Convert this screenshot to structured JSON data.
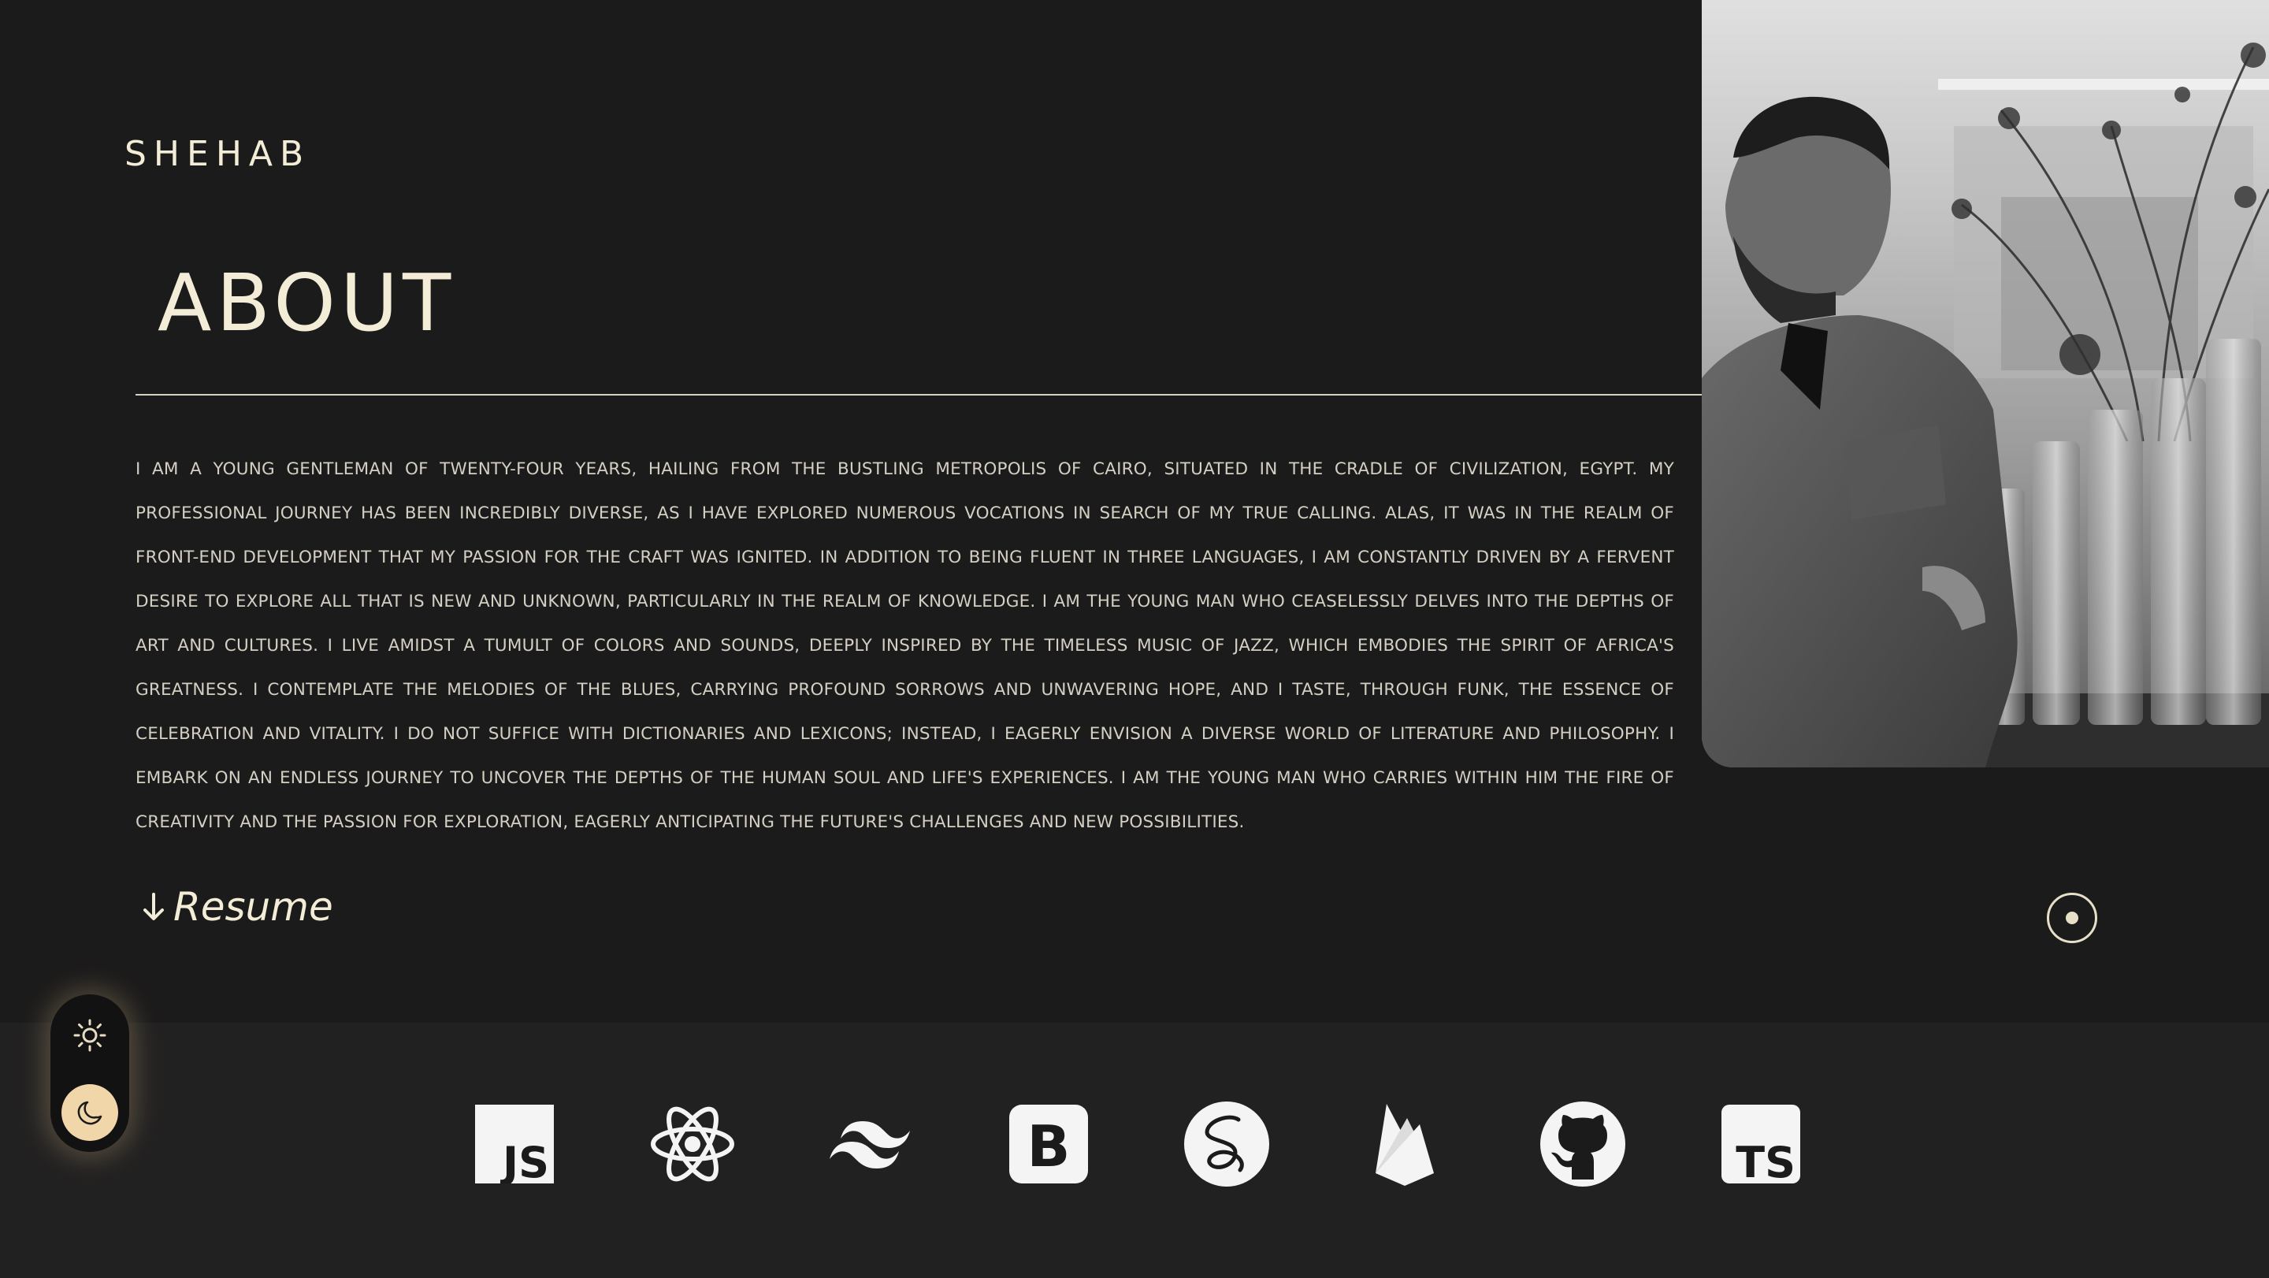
{
  "brand": {
    "logo_text": "SHEHAB"
  },
  "about": {
    "title": "ABOUT",
    "body": "I am a young gentleman of twenty-four years, hailing from the bustling metropolis of Cairo, situated in the cradle of civilization, Egypt. My professional journey has been incredibly diverse, as I have explored numerous vocations in search of my true calling. Alas, it was in the realm of front-end development that my passion for the craft was ignited. In addition to being fluent in three languages, I am constantly driven by a fervent desire to explore all that is new and unknown, particularly in the realm of knowledge. I am the young man who ceaselessly delves into the depths of art and cultures. I live amidst a tumult of colors and sounds, deeply inspired by the timeless music of jazz, which embodies the spirit of Africa's greatness. I contemplate the melodies of the blues, carrying profound sorrows and unwavering hope, and I taste, through funk, the essence of celebration and vitality. I do not suffice with dictionaries and lexicons; instead, I eagerly envision a diverse world of literature and philosophy. I embark on an endless journey to uncover the depths of the human soul and life's experiences. I am the young man who carries within him the fire of creativity and the passion for exploration, eagerly anticipating the future's challenges and new possibilities."
  },
  "resume": {
    "label": "Resume",
    "icon": "arrow-down-icon"
  },
  "photo": {
    "kind": "grayscale portrait of man beside flower vases"
  },
  "theme_toggle": {
    "options": [
      "light",
      "dark"
    ],
    "selected": "dark",
    "icons": [
      "sun-icon",
      "moon-icon"
    ]
  },
  "tech_stack": {
    "items": [
      {
        "name": "JavaScript",
        "icon": "javascript-icon",
        "label": "JS"
      },
      {
        "name": "React",
        "icon": "react-icon"
      },
      {
        "name": "Tailwind CSS",
        "icon": "tailwind-icon"
      },
      {
        "name": "Bootstrap",
        "icon": "bootstrap-icon",
        "label": "B"
      },
      {
        "name": "Sass",
        "icon": "sass-icon"
      },
      {
        "name": "Firebase",
        "icon": "firebase-icon"
      },
      {
        "name": "GitHub",
        "icon": "github-icon"
      },
      {
        "name": "TypeScript",
        "icon": "typescript-icon",
        "label": "TS"
      }
    ]
  },
  "colors": {
    "background": "#1c1b1b",
    "footer": "#222121",
    "accent": "#f3ecd6",
    "toggle_active": "#f1d6a9"
  }
}
